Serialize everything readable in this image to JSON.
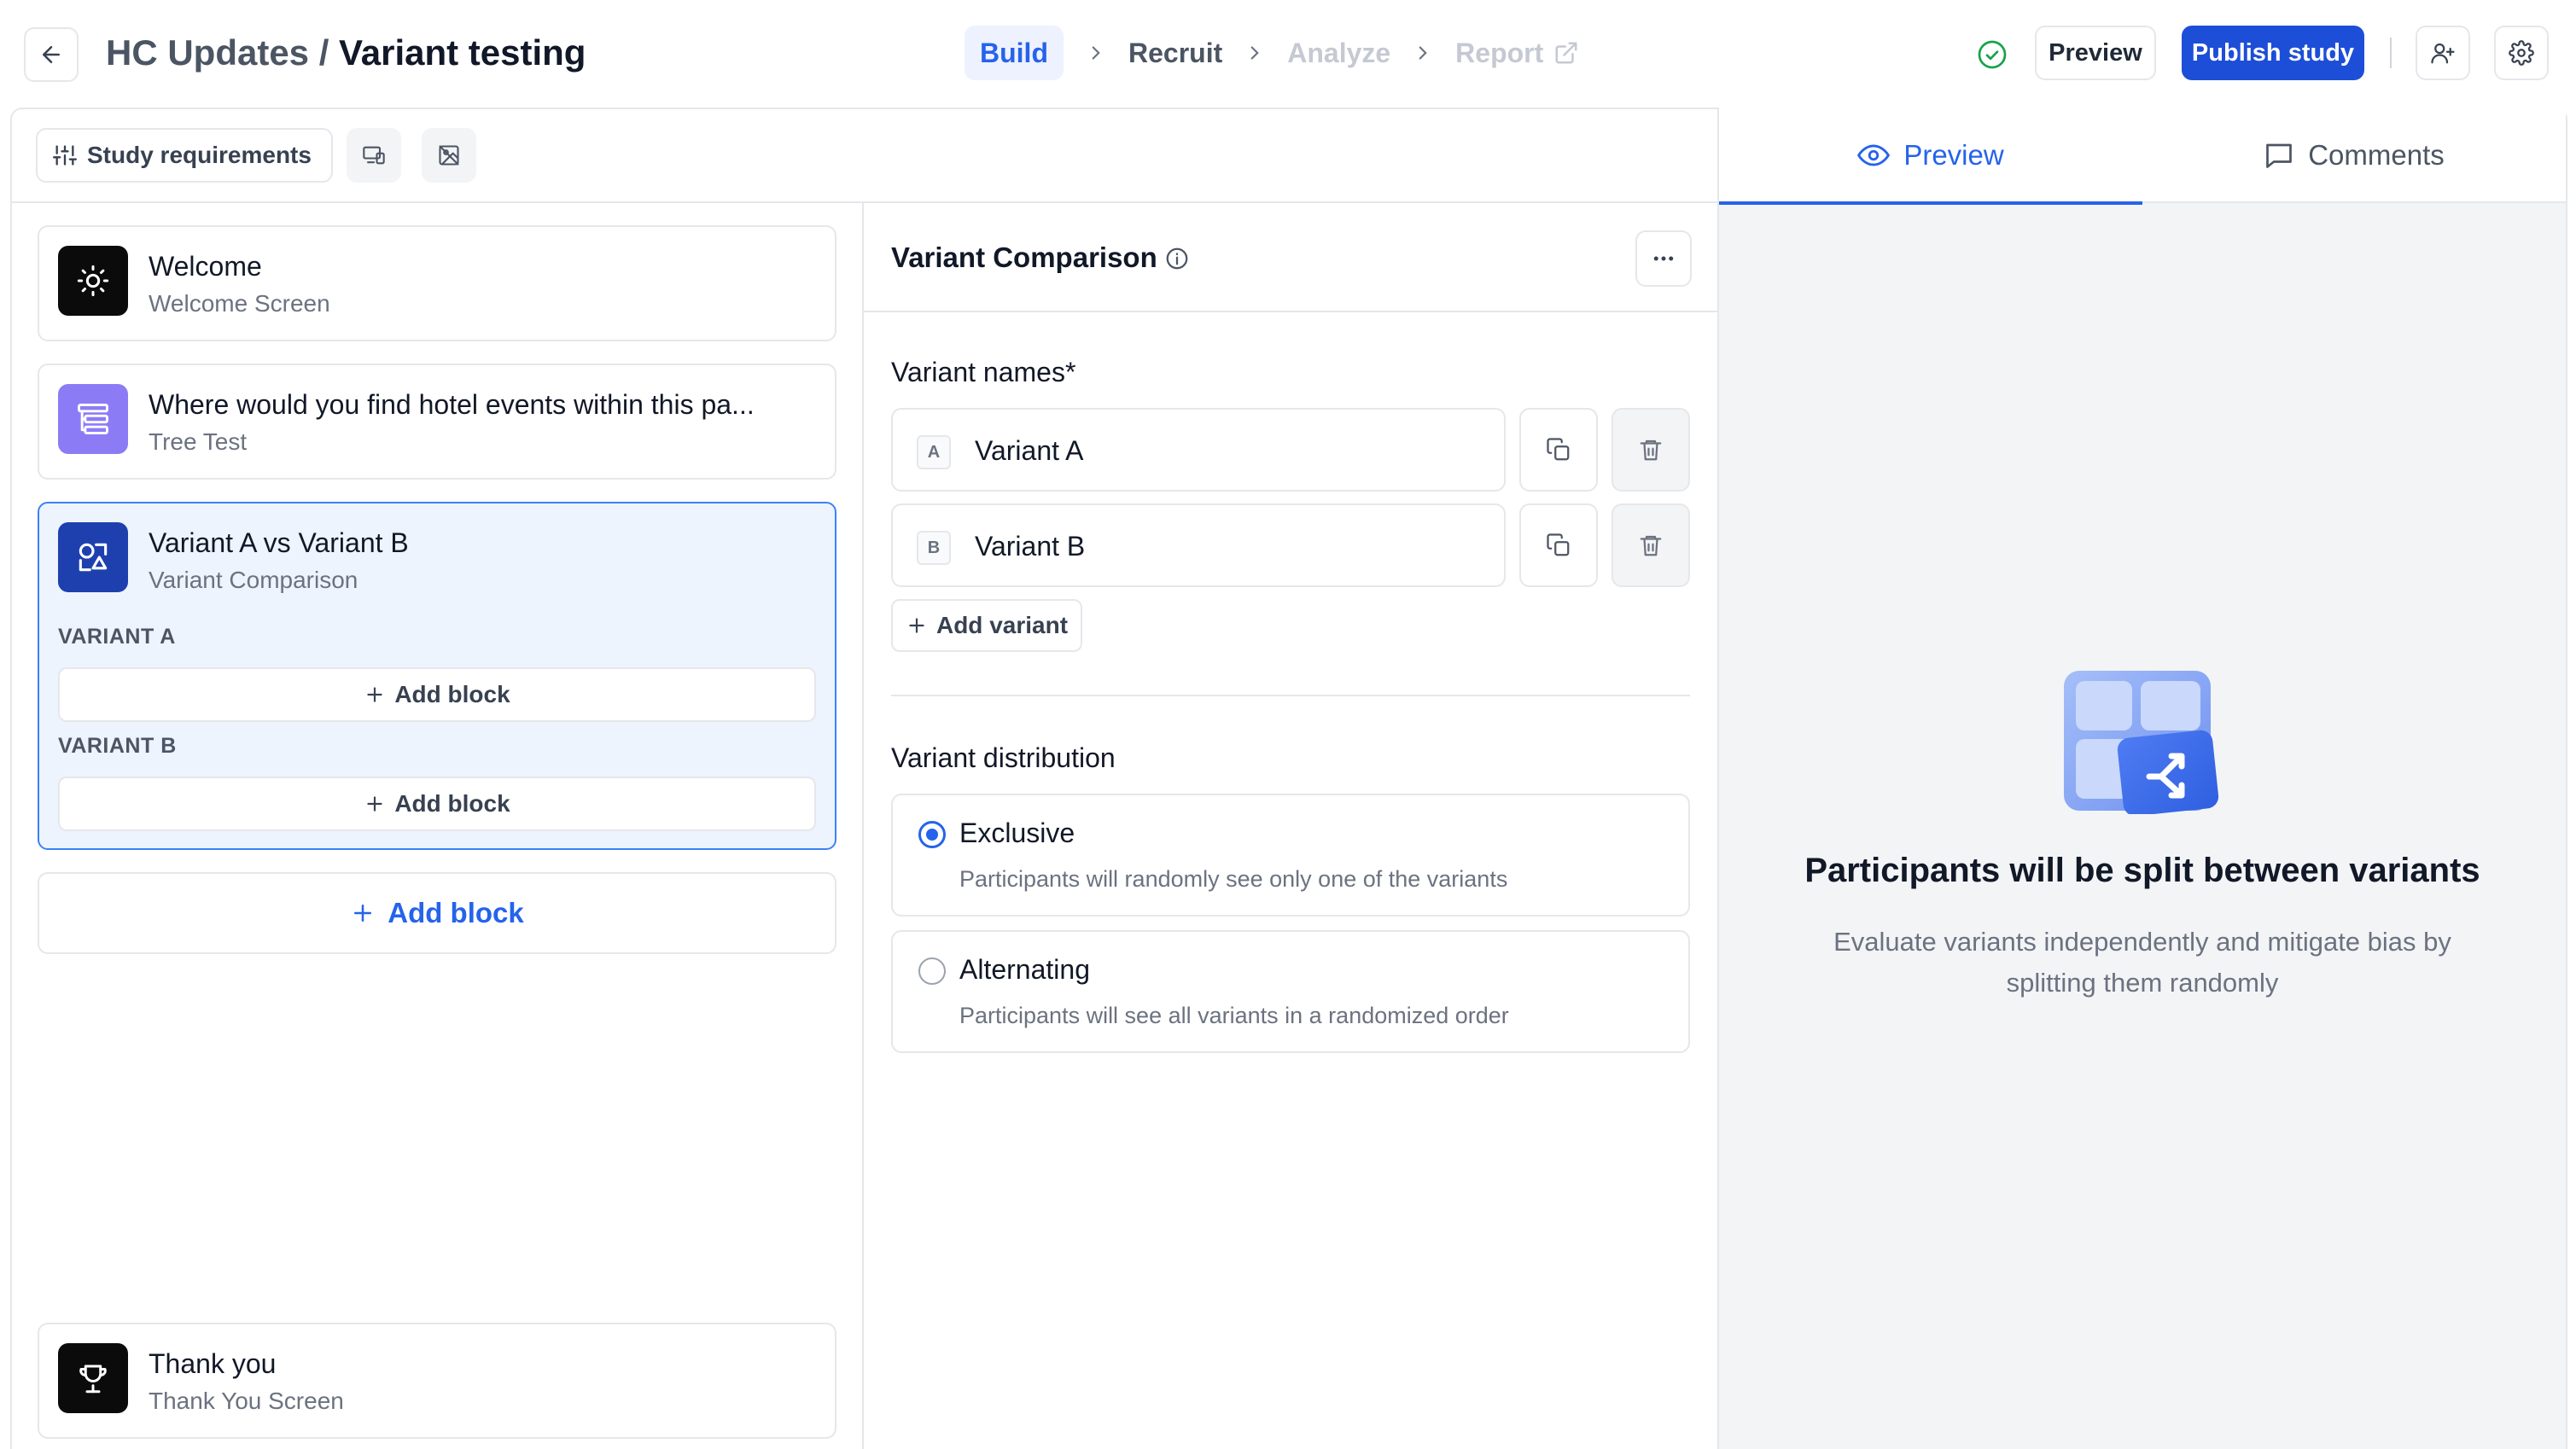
{
  "header": {
    "breadcrumb_parent": "HC Updates /",
    "breadcrumb_current": "Variant testing",
    "steps": [
      "Build",
      "Recruit",
      "Analyze",
      "Report"
    ],
    "preview_label": "Preview",
    "publish_label": "Publish study"
  },
  "toolbar": {
    "study_requirements_label": "Study requirements"
  },
  "blocks": [
    {
      "title": "Welcome",
      "subtitle": "Welcome Screen",
      "icon": "sun-icon"
    },
    {
      "title": "Where would you find hotel events within this pa...",
      "subtitle": "Tree Test",
      "icon": "tree-test-icon"
    },
    {
      "title": "Variant A vs Variant B",
      "subtitle": "Variant Comparison",
      "icon": "variant-comparison-icon"
    },
    {
      "title": "Thank you",
      "subtitle": "Thank You Screen",
      "icon": "trophy-icon"
    }
  ],
  "variant_block": {
    "variant_a_label": "VARIANT A",
    "variant_b_label": "VARIANT B",
    "add_block_label": "Add block"
  },
  "add_block_main_label": "Add block",
  "editor": {
    "title": "Variant Comparison",
    "variant_names_label": "Variant names*",
    "variants": [
      {
        "letter": "A",
        "name": "Variant A"
      },
      {
        "letter": "B",
        "name": "Variant B"
      }
    ],
    "add_variant_label": "Add variant",
    "distribution_label": "Variant distribution",
    "options": [
      {
        "title": "Exclusive",
        "desc": "Participants will randomly see only one of the variants",
        "selected": true
      },
      {
        "title": "Alternating",
        "desc": "Participants will see all variants in a randomized order",
        "selected": false
      }
    ]
  },
  "right_panel": {
    "tabs": [
      "Preview",
      "Comments"
    ],
    "active_tab": "Preview",
    "title": "Participants will be split between variants",
    "description": "Evaluate variants independently and mitigate bias by splitting them randomly"
  },
  "colors": {
    "accent": "#2563eb",
    "publish": "#1d4ed8",
    "selected_bg": "#eef4fd",
    "tree_icon": "#8b7cf6",
    "variant_icon": "#1e40af"
  }
}
